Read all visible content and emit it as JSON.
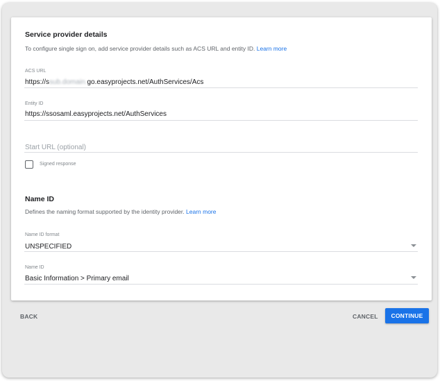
{
  "sp_details": {
    "title": "Service provider details",
    "description": "To configure single sign on, add service provider details such as ACS URL and entity ID.",
    "learn_more": "Learn more"
  },
  "acs_url": {
    "label": "ACS URL",
    "value_prefix": "https://s",
    "value_redacted": "sub.domain.",
    "value_suffix": "go.easyprojects.net/AuthServices/Acs"
  },
  "entity_id": {
    "label": "Entity ID",
    "value": "https://ssosaml.easyprojects.net/AuthServices"
  },
  "start_url": {
    "placeholder": "Start URL (optional)"
  },
  "signed_response": {
    "label": "Signed response",
    "checked": false
  },
  "name_id_section": {
    "title": "Name ID",
    "description": "Defines the naming format supported by the identity provider.",
    "learn_more": "Learn more"
  },
  "name_id_format": {
    "label": "Name ID format",
    "value": "UNSPECIFIED"
  },
  "name_id": {
    "label": "Name ID",
    "value": "Basic Information > Primary email"
  },
  "footer": {
    "back_label": "BACK",
    "cancel_label": "CANCEL",
    "continue_label": "CONTINUE"
  },
  "colors": {
    "accent": "#1a73e8",
    "panel": "#e9e9e9"
  }
}
